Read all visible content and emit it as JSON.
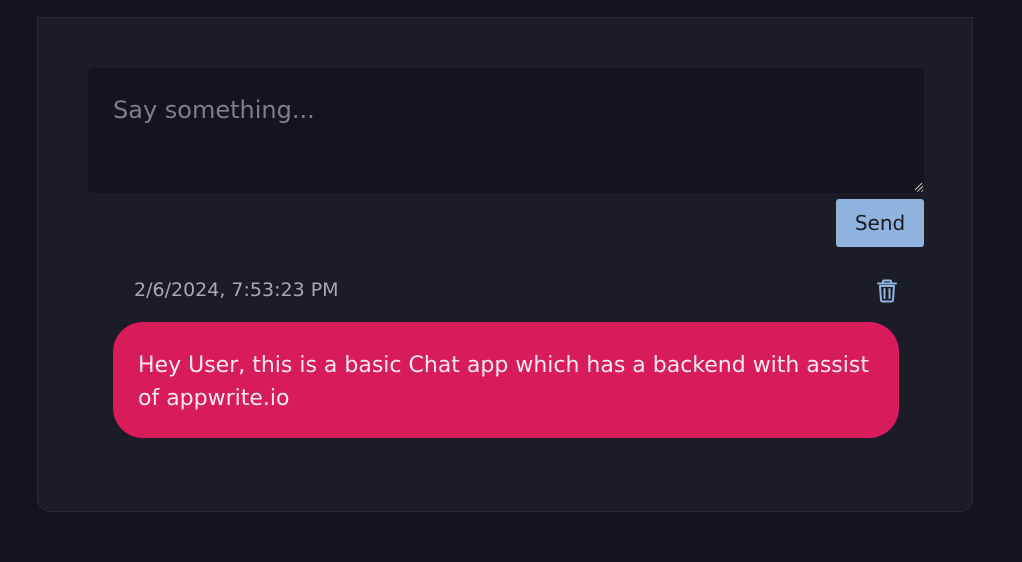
{
  "composer": {
    "placeholder": "Say something...",
    "value": ""
  },
  "actions": {
    "send_label": "Send"
  },
  "messages": [
    {
      "timestamp": "2/6/2024, 7:53:23 PM",
      "body": "Hey User, this is a basic Chat app which has a backend with assist of appwrite.io",
      "delete_icon": "trash-icon"
    }
  ],
  "colors": {
    "page_background": "#14141e",
    "card_background": "#1c1c26",
    "send_button": "#8fb4e0",
    "message_bubble": "#d81b5b",
    "icon_color": "#8fb4e0"
  }
}
